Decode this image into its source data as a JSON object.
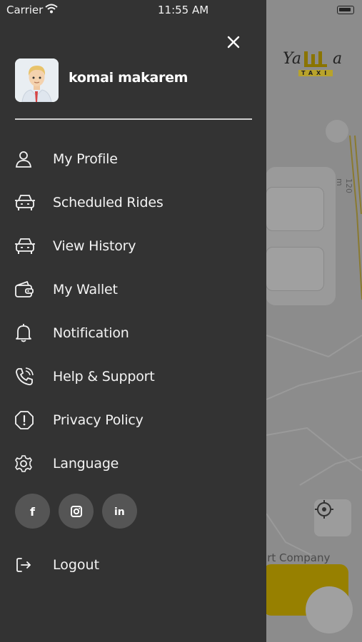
{
  "status_bar": {
    "carrier": "Carrier",
    "time": "11:55 AM"
  },
  "logo": {
    "part1": "Ya",
    "part2": "a",
    "taxi": "TAXI"
  },
  "user": {
    "name": "komai makarem"
  },
  "menu": [
    {
      "label": "My Profile",
      "icon": "user-icon"
    },
    {
      "label": "Scheduled Rides",
      "icon": "car-icon"
    },
    {
      "label": "View History",
      "icon": "car-icon"
    },
    {
      "label": "My Wallet",
      "icon": "wallet-icon"
    },
    {
      "label": "Notification",
      "icon": "bell-icon"
    },
    {
      "label": "Help & Support",
      "icon": "phone-icon"
    },
    {
      "label": "Privacy Policy",
      "icon": "shield-alert-icon"
    },
    {
      "label": "Language",
      "icon": "gear-icon"
    }
  ],
  "social": [
    {
      "label": "f",
      "icon": "facebook-icon"
    },
    {
      "label": "instagram",
      "icon": "instagram-icon"
    },
    {
      "label": "in",
      "icon": "linkedin-icon"
    }
  ],
  "logout": {
    "label": "Logout",
    "icon": "logout-icon"
  },
  "map": {
    "company_text": "art Company",
    "street_text": "120 m"
  },
  "colors": {
    "drawer_bg": "#333333",
    "brand_yellow": "#f2c500",
    "overlay": "#8c8c8c"
  }
}
